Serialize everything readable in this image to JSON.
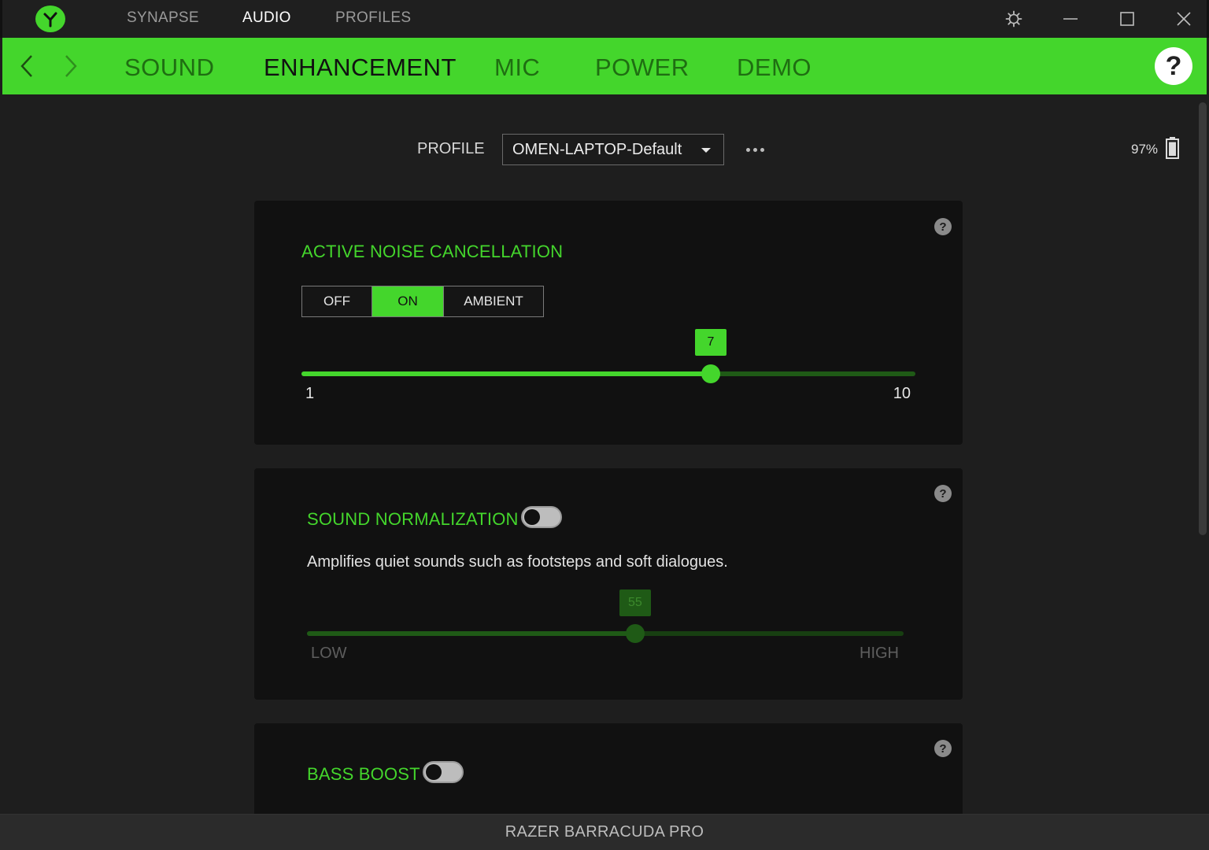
{
  "titlebar": {
    "tabs": [
      {
        "label": "SYNAPSE",
        "active": false
      },
      {
        "label": "AUDIO",
        "active": true
      },
      {
        "label": "PROFILES",
        "active": false
      }
    ]
  },
  "subnav": {
    "tabs": [
      {
        "label": "SOUND",
        "active": false
      },
      {
        "label": "ENHANCEMENT",
        "active": true
      },
      {
        "label": "MIC",
        "active": false
      },
      {
        "label": "POWER",
        "active": false
      },
      {
        "label": "DEMO",
        "active": false
      }
    ],
    "help_label": "?"
  },
  "profile": {
    "label": "PROFILE",
    "selected": "OMEN-LAPTOP-Default"
  },
  "battery": {
    "percent_text": "97%",
    "level": 0.97
  },
  "anc": {
    "title": "ACTIVE NOISE CANCELLATION",
    "modes": [
      "OFF",
      "ON",
      "AMBIENT"
    ],
    "selected_mode": "ON",
    "slider": {
      "min": 1,
      "max": 10,
      "value": 7,
      "min_label": "1",
      "max_label": "10",
      "value_label": "7"
    }
  },
  "normalization": {
    "title": "SOUND NORMALIZATION",
    "enabled": false,
    "description": "Amplifies quiet sounds such as footsteps and soft dialogues.",
    "slider": {
      "min": 0,
      "max": 100,
      "value": 55,
      "min_label": "LOW",
      "max_label": "HIGH",
      "value_label": "55"
    }
  },
  "bass_boost": {
    "title": "BASS BOOST",
    "enabled": false
  },
  "card_help_label": "?",
  "footer": {
    "device_name": "RAZER BARRACUDA PRO"
  },
  "colors": {
    "accent": "#44d62c",
    "accent_dim": "#1f5a16",
    "background": "#1e1e1e",
    "card": "#111111"
  }
}
